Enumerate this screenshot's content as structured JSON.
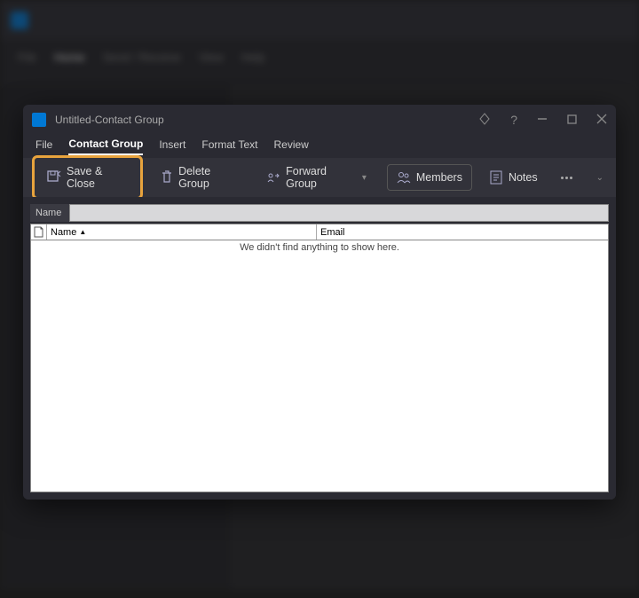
{
  "titlebar": {
    "title_left": "Untitled",
    "title_sep": "  -  ",
    "title_right": "Contact Group"
  },
  "tabs": {
    "file": "File",
    "contact_group": "Contact Group",
    "insert": "Insert",
    "format_text": "Format Text",
    "review": "Review"
  },
  "ribbon": {
    "save_close": "Save & Close",
    "delete_group": "Delete Group",
    "forward_group": "Forward Group",
    "members": "Members",
    "notes": "Notes"
  },
  "name_row": {
    "label": "Name"
  },
  "columns": {
    "name": "Name",
    "email": "Email"
  },
  "empty": "We didn't find anything to show here."
}
